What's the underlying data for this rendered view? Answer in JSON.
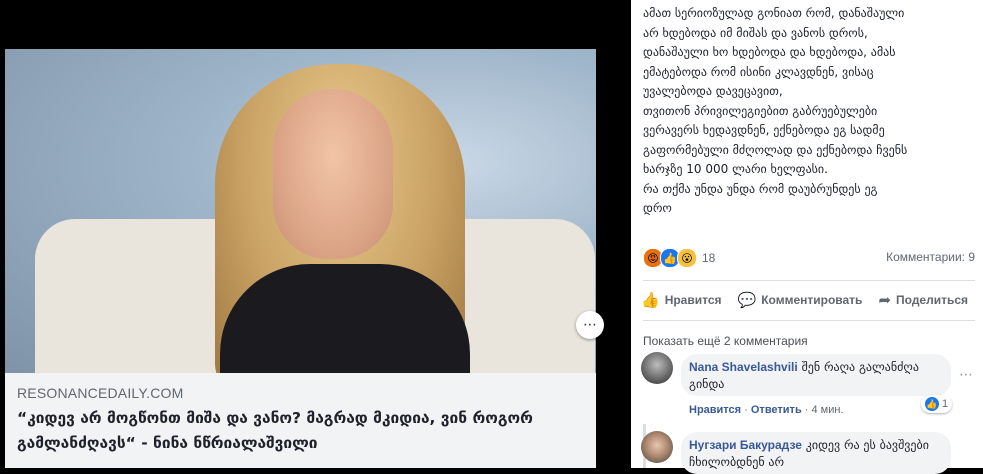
{
  "link_preview": {
    "domain": "RESONANCEDAILY.COM",
    "headline": "“კიდევ არ მოგწონთ მიშა და ვანო? მაგრად მკიდია, ვინ როგორ გამლანძღავს“ - ნინა ნწრიალაშვილი",
    "more_icon": "⋯"
  },
  "post": {
    "text": "ამათ სერიოზულად გონიათ რომ, დანაშაული\nარ ხდებოდა იმ მიშას და ვანოს დროს,\nდანაშაული ხო ხდებოდა და ხდებოდა, ამას\nემატებოდა რომ ისინი კლავდნენ, ვისაც\nუვალებოდა დავეცავით,\nთვითონ პრივილეგიებით გაბრუებულები\nვერავერს ხედავდნენ, ექნებოდა ეგ სადმე\nგაფორმებული მძღოლად და ექნებოდა ჩვენს\nხარჯზე 10 000 ლარი ხელფასი.\nრა თქმა უნდა უნდა რომ დაუბრუნდეს ეგ\nდრო",
    "reaction_count": "18",
    "comments_count": "Комментарии: 9",
    "actions": {
      "like": "Нравится",
      "comment": "Комментировать",
      "share": "Поделиться"
    },
    "show_more": "Показать ещё 2 комментария"
  },
  "comments": [
    {
      "author": "Nana Shavelashvili",
      "text": "შენ რაღა გალანძღა გინდა",
      "like_label": "Нравится",
      "reply_label": "Ответить",
      "time": "4 мин.",
      "likes": "1"
    },
    {
      "author": "Нугзари Бакурадзе",
      "text": "კიდევ რა ეს ბავშვები ჩხილობდნენ არ"
    }
  ]
}
